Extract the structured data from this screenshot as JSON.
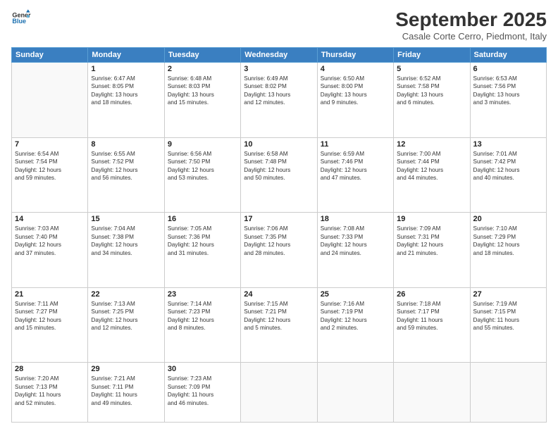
{
  "header": {
    "logo_line1": "General",
    "logo_line2": "Blue",
    "month": "September 2025",
    "location": "Casale Corte Cerro, Piedmont, Italy"
  },
  "days_of_week": [
    "Sunday",
    "Monday",
    "Tuesday",
    "Wednesday",
    "Thursday",
    "Friday",
    "Saturday"
  ],
  "weeks": [
    [
      {
        "day": "",
        "info": ""
      },
      {
        "day": "1",
        "info": "Sunrise: 6:47 AM\nSunset: 8:05 PM\nDaylight: 13 hours\nand 18 minutes."
      },
      {
        "day": "2",
        "info": "Sunrise: 6:48 AM\nSunset: 8:03 PM\nDaylight: 13 hours\nand 15 minutes."
      },
      {
        "day": "3",
        "info": "Sunrise: 6:49 AM\nSunset: 8:02 PM\nDaylight: 13 hours\nand 12 minutes."
      },
      {
        "day": "4",
        "info": "Sunrise: 6:50 AM\nSunset: 8:00 PM\nDaylight: 13 hours\nand 9 minutes."
      },
      {
        "day": "5",
        "info": "Sunrise: 6:52 AM\nSunset: 7:58 PM\nDaylight: 13 hours\nand 6 minutes."
      },
      {
        "day": "6",
        "info": "Sunrise: 6:53 AM\nSunset: 7:56 PM\nDaylight: 13 hours\nand 3 minutes."
      }
    ],
    [
      {
        "day": "7",
        "info": "Sunrise: 6:54 AM\nSunset: 7:54 PM\nDaylight: 12 hours\nand 59 minutes."
      },
      {
        "day": "8",
        "info": "Sunrise: 6:55 AM\nSunset: 7:52 PM\nDaylight: 12 hours\nand 56 minutes."
      },
      {
        "day": "9",
        "info": "Sunrise: 6:56 AM\nSunset: 7:50 PM\nDaylight: 12 hours\nand 53 minutes."
      },
      {
        "day": "10",
        "info": "Sunrise: 6:58 AM\nSunset: 7:48 PM\nDaylight: 12 hours\nand 50 minutes."
      },
      {
        "day": "11",
        "info": "Sunrise: 6:59 AM\nSunset: 7:46 PM\nDaylight: 12 hours\nand 47 minutes."
      },
      {
        "day": "12",
        "info": "Sunrise: 7:00 AM\nSunset: 7:44 PM\nDaylight: 12 hours\nand 44 minutes."
      },
      {
        "day": "13",
        "info": "Sunrise: 7:01 AM\nSunset: 7:42 PM\nDaylight: 12 hours\nand 40 minutes."
      }
    ],
    [
      {
        "day": "14",
        "info": "Sunrise: 7:03 AM\nSunset: 7:40 PM\nDaylight: 12 hours\nand 37 minutes."
      },
      {
        "day": "15",
        "info": "Sunrise: 7:04 AM\nSunset: 7:38 PM\nDaylight: 12 hours\nand 34 minutes."
      },
      {
        "day": "16",
        "info": "Sunrise: 7:05 AM\nSunset: 7:36 PM\nDaylight: 12 hours\nand 31 minutes."
      },
      {
        "day": "17",
        "info": "Sunrise: 7:06 AM\nSunset: 7:35 PM\nDaylight: 12 hours\nand 28 minutes."
      },
      {
        "day": "18",
        "info": "Sunrise: 7:08 AM\nSunset: 7:33 PM\nDaylight: 12 hours\nand 24 minutes."
      },
      {
        "day": "19",
        "info": "Sunrise: 7:09 AM\nSunset: 7:31 PM\nDaylight: 12 hours\nand 21 minutes."
      },
      {
        "day": "20",
        "info": "Sunrise: 7:10 AM\nSunset: 7:29 PM\nDaylight: 12 hours\nand 18 minutes."
      }
    ],
    [
      {
        "day": "21",
        "info": "Sunrise: 7:11 AM\nSunset: 7:27 PM\nDaylight: 12 hours\nand 15 minutes."
      },
      {
        "day": "22",
        "info": "Sunrise: 7:13 AM\nSunset: 7:25 PM\nDaylight: 12 hours\nand 12 minutes."
      },
      {
        "day": "23",
        "info": "Sunrise: 7:14 AM\nSunset: 7:23 PM\nDaylight: 12 hours\nand 8 minutes."
      },
      {
        "day": "24",
        "info": "Sunrise: 7:15 AM\nSunset: 7:21 PM\nDaylight: 12 hours\nand 5 minutes."
      },
      {
        "day": "25",
        "info": "Sunrise: 7:16 AM\nSunset: 7:19 PM\nDaylight: 12 hours\nand 2 minutes."
      },
      {
        "day": "26",
        "info": "Sunrise: 7:18 AM\nSunset: 7:17 PM\nDaylight: 11 hours\nand 59 minutes."
      },
      {
        "day": "27",
        "info": "Sunrise: 7:19 AM\nSunset: 7:15 PM\nDaylight: 11 hours\nand 55 minutes."
      }
    ],
    [
      {
        "day": "28",
        "info": "Sunrise: 7:20 AM\nSunset: 7:13 PM\nDaylight: 11 hours\nand 52 minutes."
      },
      {
        "day": "29",
        "info": "Sunrise: 7:21 AM\nSunset: 7:11 PM\nDaylight: 11 hours\nand 49 minutes."
      },
      {
        "day": "30",
        "info": "Sunrise: 7:23 AM\nSunset: 7:09 PM\nDaylight: 11 hours\nand 46 minutes."
      },
      {
        "day": "",
        "info": ""
      },
      {
        "day": "",
        "info": ""
      },
      {
        "day": "",
        "info": ""
      },
      {
        "day": "",
        "info": ""
      }
    ]
  ]
}
